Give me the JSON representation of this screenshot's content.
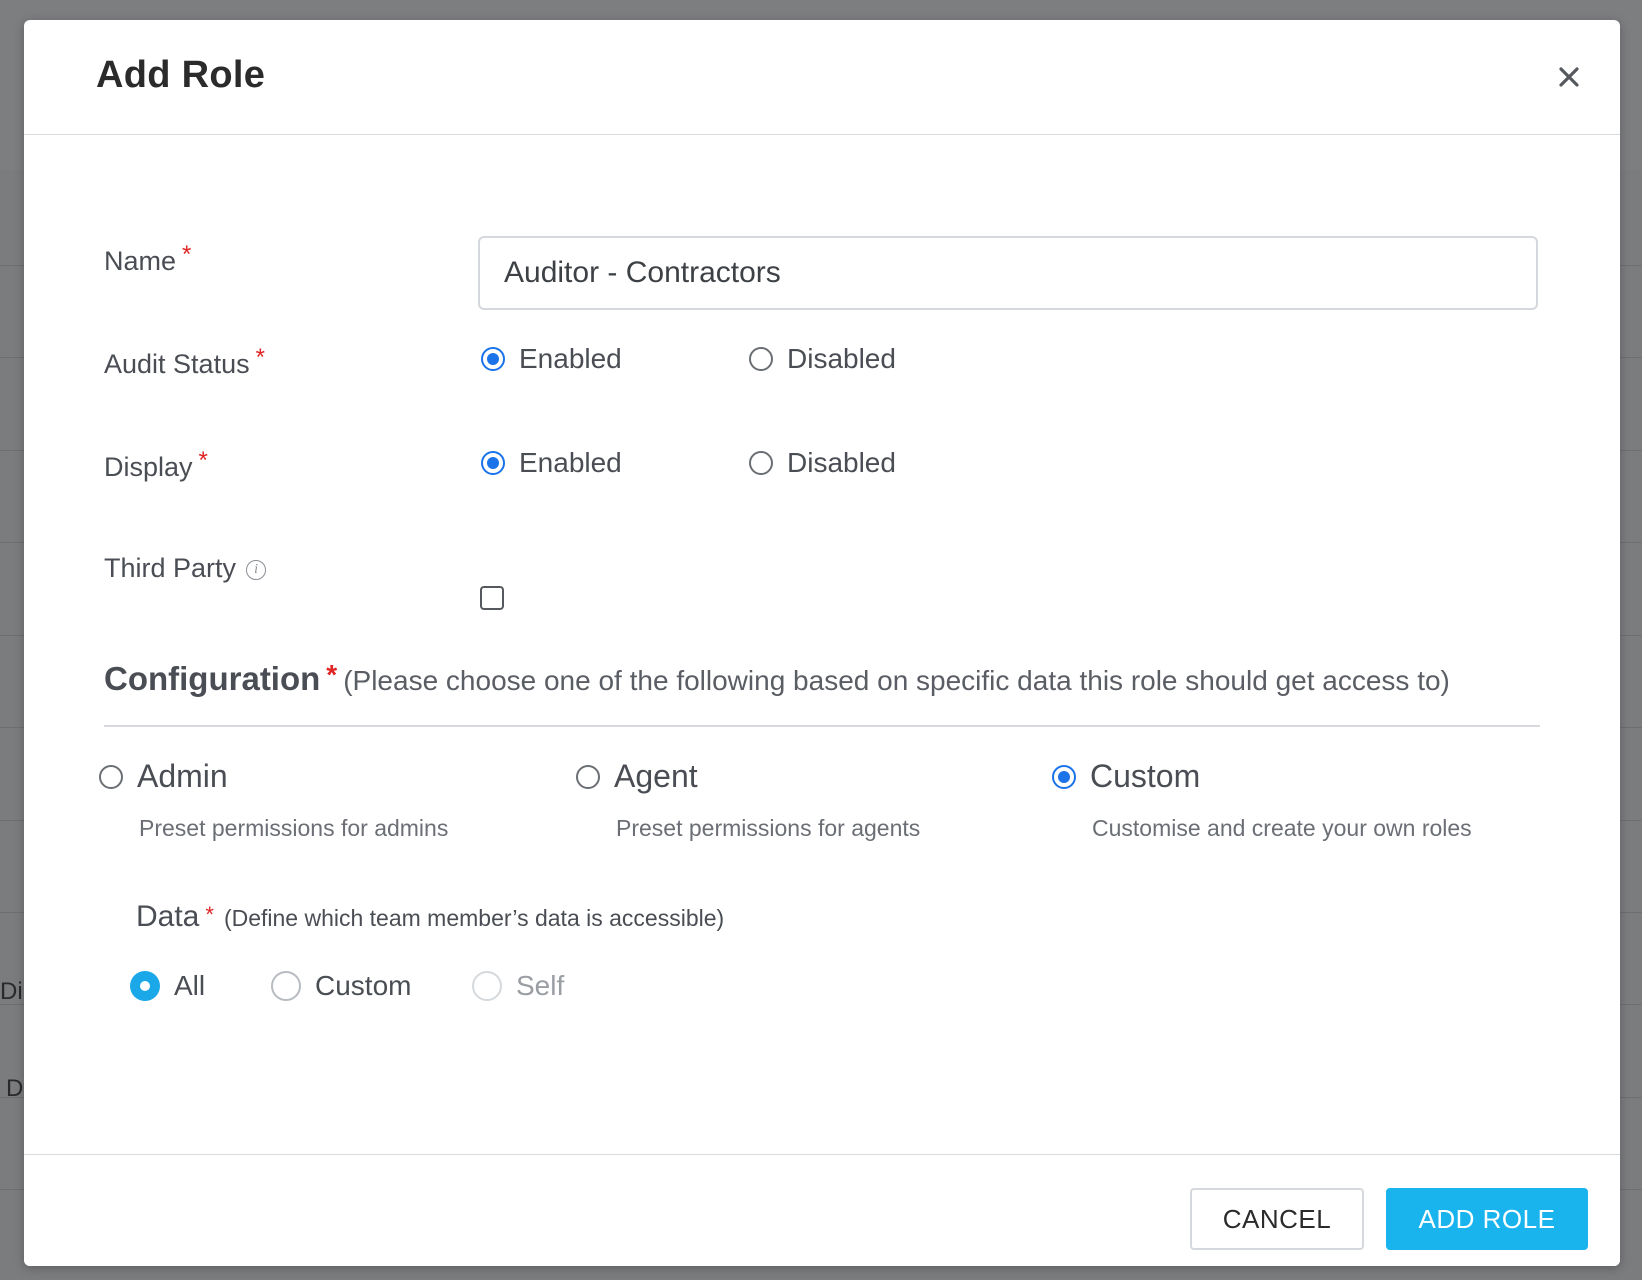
{
  "background": {
    "fragments": [
      "Di",
      "D"
    ]
  },
  "modal": {
    "title": "Add Role",
    "close_icon": "close-icon"
  },
  "form": {
    "name": {
      "label": "Name",
      "required_mark": "*",
      "value": "Auditor - Contractors"
    },
    "audit_status": {
      "label": "Audit Status",
      "required_mark": "*",
      "options": [
        {
          "label": "Enabled",
          "selected": true
        },
        {
          "label": "Disabled",
          "selected": false
        }
      ]
    },
    "display": {
      "label": "Display",
      "required_mark": "*",
      "options": [
        {
          "label": "Enabled",
          "selected": true
        },
        {
          "label": "Disabled",
          "selected": false
        }
      ]
    },
    "third_party": {
      "label": "Third Party",
      "info_icon": "info-icon",
      "checked": false
    }
  },
  "configuration": {
    "title": "Configuration",
    "required_mark": "*",
    "subtitle": "(Please choose one of the following based on specific data this role should get access to)",
    "options": [
      {
        "label": "Admin",
        "description": "Preset permissions for admins",
        "selected": false
      },
      {
        "label": "Agent",
        "description": "Preset permissions for agents",
        "selected": false
      },
      {
        "label": "Custom",
        "description": "Customise and create your own roles",
        "selected": true
      }
    ]
  },
  "data_section": {
    "label": "Data",
    "required_mark": "*",
    "hint": "(Define which team member’s data is accessible)",
    "options": [
      {
        "label": "All",
        "selected": true
      },
      {
        "label": "Custom",
        "selected": false
      },
      {
        "label": "Self",
        "selected": false,
        "disabled": true
      }
    ]
  },
  "footer": {
    "cancel_label": "CANCEL",
    "submit_label": "ADD ROLE"
  },
  "colors": {
    "primary": "#19b4ee",
    "radio_blue": "#1a73e8",
    "required": "#e02424"
  }
}
